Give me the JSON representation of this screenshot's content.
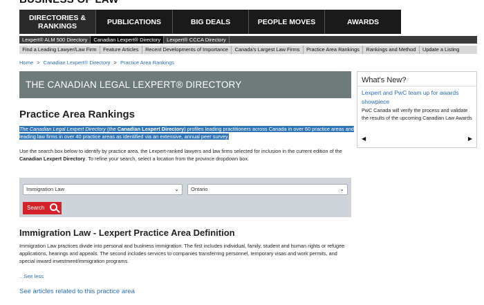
{
  "brand": {
    "name": "BUSINESS OF LAW"
  },
  "main_nav": [
    {
      "label": "DIRECTORIES & RANKINGS"
    },
    {
      "label": "PUBLICATIONS"
    },
    {
      "label": "BIG DEALS"
    },
    {
      "label": "PEOPLE MOVES"
    },
    {
      "label": "AWARDS"
    }
  ],
  "sub_nav": [
    {
      "label": "Lexpert® ALM 500 Directory"
    },
    {
      "label": "Canadian Lexpert® Directory",
      "active": true
    },
    {
      "label": "Lexpert® CCCA Directory"
    }
  ],
  "tert_nav": [
    {
      "label": "Find a Leading Lawyer/Law Firm"
    },
    {
      "label": "Feature Articles"
    },
    {
      "label": "Recent Developments of Importance"
    },
    {
      "label": "Canada's Largest Law Firms"
    },
    {
      "label": "Practice Area Rankings"
    },
    {
      "label": "Rankings and Method"
    },
    {
      "label": "Update a Listing"
    }
  ],
  "breadcrumb": {
    "home": "Home",
    "sep": ">",
    "level1": "Canadian Lexpert® Directory",
    "level2": "Practice Area Rankings"
  },
  "hero": {
    "title": "THE CANADIAN LEGAL LEXPERT® DIRECTORY"
  },
  "page": {
    "title": "Practice Area Rankings",
    "intro_em": "The Canadian Legal Lexpert Directory",
    "intro_p1": " (the ",
    "intro_b": "Canadian Lexpert Directory",
    "intro_p2": ") profiles leading practitioners across Canada in over 60 practice areas and leading law firms in over 40 practice areas as identified via an extensive, annual peer survey.",
    "instr_p1": "Use the search box below to identify by practice area, the Lexpert-ranked lawyers and law firms selected for inclusion in the current edition of the ",
    "instr_b": "Canadian Lexpert Directory",
    "instr_p2": ". To refine your search, select a location from the province dropdown box."
  },
  "search": {
    "practice_area_value": "Immigration Law",
    "province_value": "Ontario",
    "button_label": "Search"
  },
  "definition": {
    "title": "Immigration Law - Lexpert Practice Area Definition",
    "body": "Immigration Law practices divide into personal and business immigration. The first includes individual, family, student and human rights or refugee applications, hearings and appeals. The second includes services to companies transferring personnel, temporary visas and work permits, and special inward investment/immigration programs.",
    "see_less": "...See less",
    "see_articles": "See articles related to this practice area"
  },
  "whats_new": {
    "heading": "What's New?",
    "link": "Lexpert and PwC team up for awards showpiece",
    "text": "PwC Canada will verify the process and validate the results of the upcoming Canadian Law Awards",
    "prev": "◀",
    "next": "▶"
  },
  "colors": {
    "nav_bg": "#1a1a1a",
    "hero_bg": "#6e7b7a",
    "link": "#2a6fb7",
    "search_button": "#d4222a",
    "highlight": "#2f74b5"
  }
}
